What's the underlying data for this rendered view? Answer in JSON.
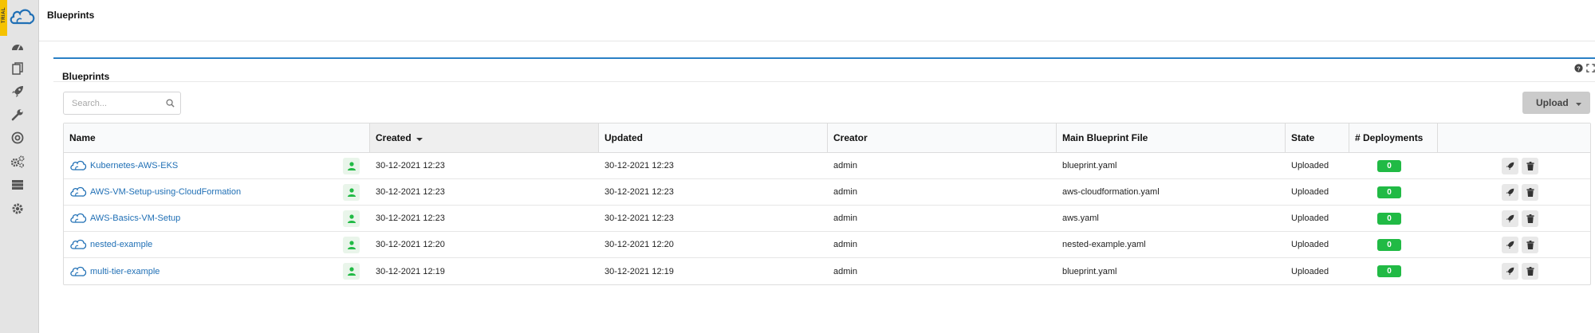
{
  "badge": {
    "trial_label": "TRIAL"
  },
  "header": {
    "title": "Blueprints"
  },
  "sidebar": {
    "items": [
      {
        "icon": "dashboard-icon"
      },
      {
        "icon": "blueprints-icon"
      },
      {
        "icon": "deployments-rocket-icon"
      },
      {
        "icon": "wrench-icon"
      },
      {
        "icon": "target-icon"
      },
      {
        "icon": "cogs-icon"
      },
      {
        "icon": "server-icon"
      },
      {
        "icon": "settings-gear-icon"
      }
    ]
  },
  "widget": {
    "title": "Blueprints",
    "search_placeholder": "Search...",
    "upload_label": "Upload",
    "columns": [
      "Name",
      "Created",
      "Updated",
      "Creator",
      "Main Blueprint File",
      "State",
      "# Deployments",
      ""
    ],
    "sorted_column": "Created",
    "rows": [
      {
        "name": "Kubernetes-AWS-EKS",
        "created": "30-12-2021 12:23",
        "updated": "30-12-2021 12:23",
        "creator": "admin",
        "file": "blueprint.yaml",
        "state": "Uploaded",
        "deployments": "0"
      },
      {
        "name": "AWS-VM-Setup-using-CloudFormation",
        "created": "30-12-2021 12:23",
        "updated": "30-12-2021 12:23",
        "creator": "admin",
        "file": "aws-cloudformation.yaml",
        "state": "Uploaded",
        "deployments": "0"
      },
      {
        "name": "AWS-Basics-VM-Setup",
        "created": "30-12-2021 12:23",
        "updated": "30-12-2021 12:23",
        "creator": "admin",
        "file": "aws.yaml",
        "state": "Uploaded",
        "deployments": "0"
      },
      {
        "name": "nested-example",
        "created": "30-12-2021 12:20",
        "updated": "30-12-2021 12:20",
        "creator": "admin",
        "file": "nested-example.yaml",
        "state": "Uploaded",
        "deployments": "0"
      },
      {
        "name": "multi-tier-example",
        "created": "30-12-2021 12:19",
        "updated": "30-12-2021 12:19",
        "creator": "admin",
        "file": "blueprint.yaml",
        "state": "Uploaded",
        "deployments": "0"
      }
    ]
  },
  "colors": {
    "accent": "#2a80c5",
    "link": "#1f6fb5",
    "success": "#21ba45",
    "trial": "#f5c200"
  }
}
